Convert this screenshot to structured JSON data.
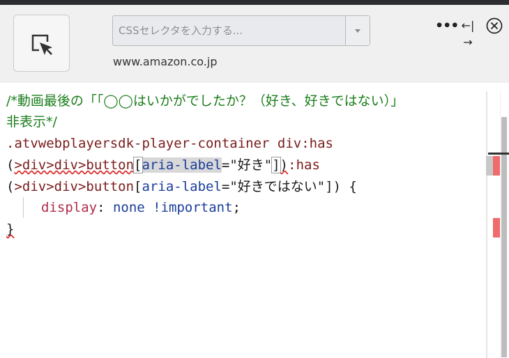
{
  "toolbar": {
    "selector_placeholder": "CSSセレクタを入力する...",
    "domain": "www.amazon.co.jp",
    "more_glyph": "•••",
    "resize_glyph": "←|→"
  },
  "editor": {
    "line1": "/*動画最後の「「◯◯はいかがでしたか？（好き、好きではない）」",
    "line2": "非表示*/",
    "line3": ".atvwebplayersdk-player-container div:has",
    "l4_a": "(",
    "l4_b": ">div>div>button",
    "l4_c": "[",
    "l4_d": "aria-label",
    "l4_e": "=\"好き\"",
    "l4_f": "]",
    "l4_g": ")",
    "l4_h": ":has",
    "l5_a": "(",
    "l5_b": ">div>div>button",
    "l5_c": "[",
    "l5_d": "aria-label",
    "l5_e": "=\"好きではない\"])",
    "l5_f": " {",
    "l6_prop": "display",
    "l6_colon": ": ",
    "l6_val": "none !important",
    "l6_semi": ";",
    "l7": "}"
  },
  "colors": {
    "comment": "#1b7d1b",
    "selector": "#7a1b1b",
    "attribute": "#1a3d9a",
    "property": "#b02a4a",
    "error_marker": "#f06b6b"
  },
  "icons": [
    "element-picker-icon",
    "dropdown-chevron-icon",
    "more-options-icon",
    "resize-icon",
    "close-icon"
  ]
}
